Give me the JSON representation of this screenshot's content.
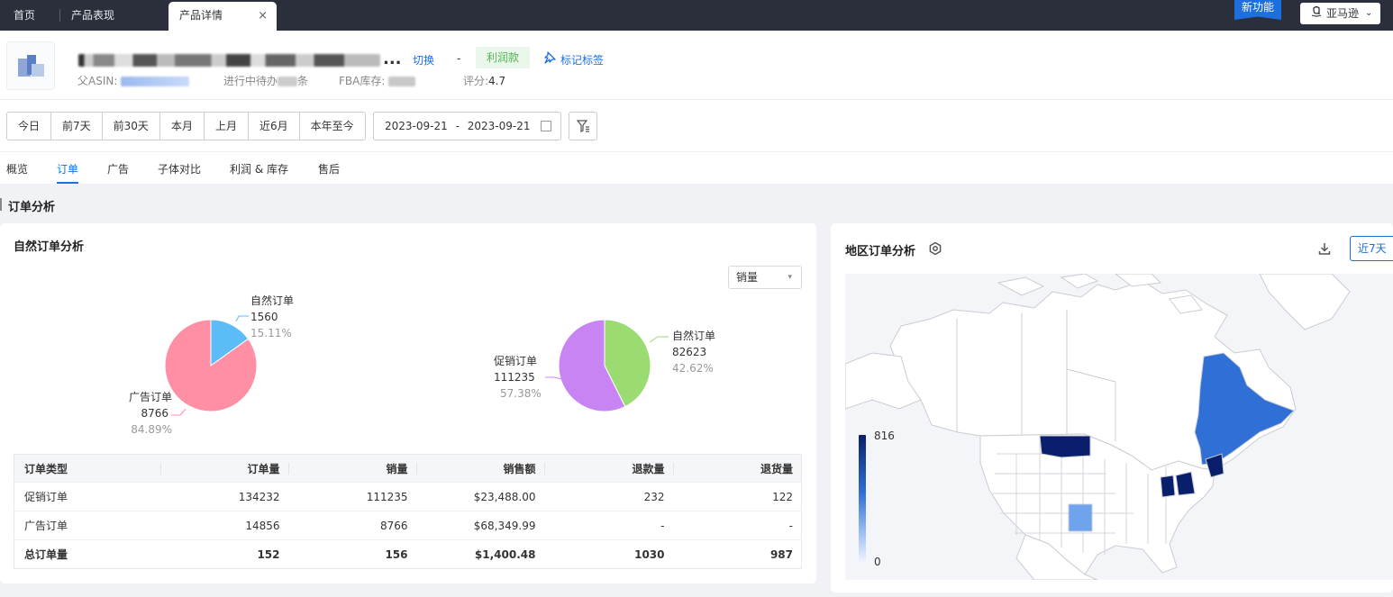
{
  "tabs": [
    {
      "label": "首页"
    },
    {
      "label": "产品表现"
    },
    {
      "label": "产品详情",
      "close": "×"
    }
  ],
  "top_right": {
    "new_feature": "新功能",
    "marketplace": "亚马逊",
    "marketplace_caret": "⌄"
  },
  "product": {
    "title_ellipsis": "...",
    "switch_label": "切换",
    "dash": "-",
    "profit_tag": "利润款",
    "mark_tag_label": "标记标签",
    "parent_asin_label": "父ASIN:",
    "pending_label": "进行中待办",
    "pending_suffix": "条",
    "fba_label": "FBA库存:",
    "rating_label": "评分:",
    "rating_value": "4.7"
  },
  "date_ranges": [
    "今日",
    "前7天",
    "前30天",
    "本月",
    "上月",
    "近6月",
    "本年至今"
  ],
  "date_picker": {
    "start": "2023-09-21",
    "sep": "-",
    "end": "2023-09-21"
  },
  "subnav": [
    "概览",
    "订单",
    "广告",
    "子体对比",
    "利润 & 库存",
    "售后"
  ],
  "section_title": "订单分析",
  "natural_card": {
    "title": "自然订单分析",
    "select_value": "销量",
    "left_pie": {
      "slices": [
        {
          "name": "自然订单",
          "value": "1560",
          "pct": "15.11%",
          "frac": 0.1511,
          "color": "#5bbcf8"
        },
        {
          "name": "广告订单",
          "value": "8766",
          "pct": "84.89%",
          "frac": 0.8489,
          "color": "#fe8fa5"
        }
      ]
    },
    "right_pie": {
      "slices": [
        {
          "name": "自然订单",
          "value": "82623",
          "pct": "42.62%",
          "frac": 0.4262,
          "color": "#9bdc72"
        },
        {
          "name": "促销订单",
          "value": "111235",
          "pct": "57.38%",
          "frac": 0.5738,
          "color": "#c784f2"
        }
      ]
    },
    "table": {
      "headers": [
        "订单类型",
        "订单量",
        "销量",
        "销售额",
        "退款量",
        "退货量"
      ],
      "rows": [
        [
          "促销订单",
          "134232",
          "111235",
          "$23,488.00",
          "232",
          "122"
        ],
        [
          "广告订单",
          "14856",
          "8766",
          "$68,349.99",
          "-",
          "-"
        ],
        [
          "总订单量",
          "152",
          "156",
          "$1,400.48",
          "1030",
          "987"
        ]
      ]
    }
  },
  "region_card": {
    "title": "地区订单分析",
    "range_label": "近7天",
    "legend_max": "816",
    "legend_min": "0"
  },
  "colors": {
    "accent": "#1d6fe0",
    "dark_bar": "#2b2f3b"
  },
  "icons": [
    "close-icon",
    "amazon-icon",
    "chevron-down-icon",
    "pin-icon",
    "calendar-icon",
    "filter-icon",
    "settings-icon",
    "download-icon"
  ]
}
